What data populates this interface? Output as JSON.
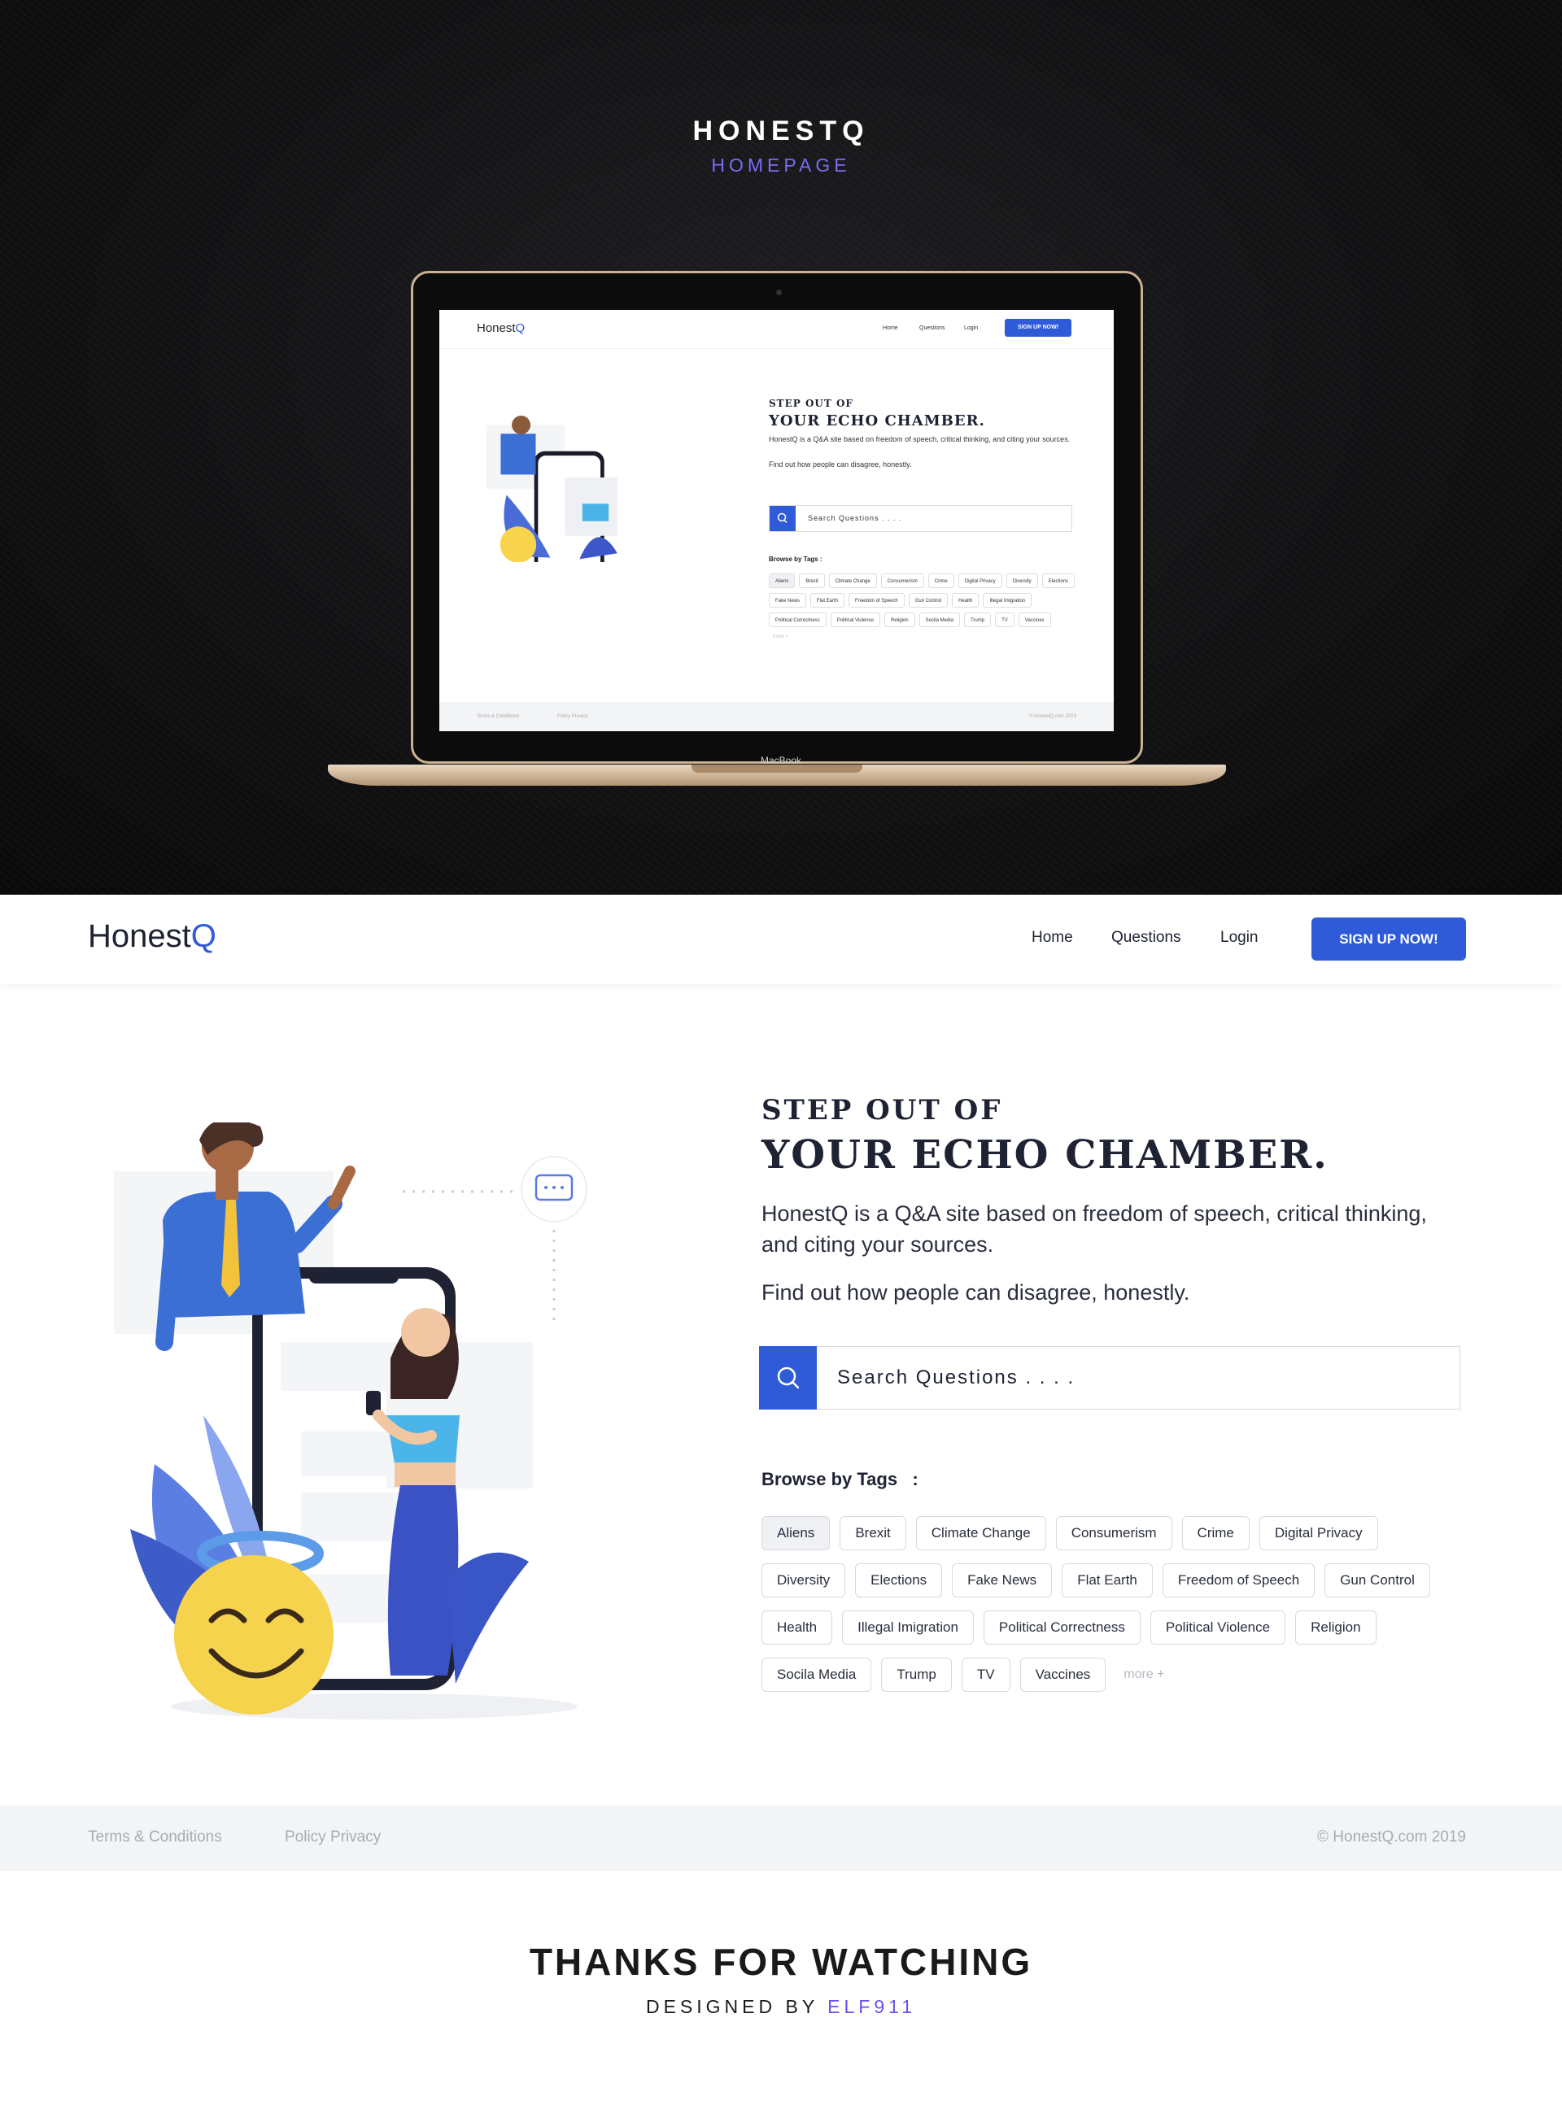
{
  "showcase": {
    "title": "HONESTQ",
    "subtitle": "HOMEPAGE",
    "laptop_label": "MacBook"
  },
  "header": {
    "logo": {
      "text": "Honest",
      "accent": "Q"
    },
    "nav": [
      {
        "label": "Home"
      },
      {
        "label": "Questions"
      },
      {
        "label": "Login"
      }
    ],
    "signup_label": "SIGN UP NOW!"
  },
  "hero": {
    "heading_small": "STEP OUT OF",
    "heading_large": "YOUR ECHO CHAMBER.",
    "description": "HonestQ is a Q&A site based on freedom of speech, critical thinking, and citing your sources.",
    "tagline": "Find out how people can disagree, honestly."
  },
  "search": {
    "placeholder": "Search Questions . . . .",
    "icon": "search-icon"
  },
  "browse": {
    "label": "Browse by Tags   :",
    "tags": [
      "Aliens",
      "Brexit",
      "Climate Change",
      "Consumerism",
      "Crime",
      "Digital Privacy",
      "Diversity",
      "Elections",
      "Fake News",
      "Flat Earth",
      "Freedom of Speech",
      "Gun Control",
      "Health",
      "Illegal Imigration",
      "Political Correctness",
      "Political Violence",
      "Religion",
      "Socila Media",
      "Trump",
      "TV",
      "Vaccines"
    ],
    "more_label": "more +"
  },
  "footer": {
    "terms": "Terms & Conditions",
    "privacy": "Policy Privacy",
    "copyright": "© HonestQ.com 2019"
  },
  "closing": {
    "thanks": "THANKS FOR WATCHING",
    "designed_by": "DESIGNED BY",
    "author": "ELF911"
  },
  "colors": {
    "accent": "#2f5bd8",
    "subtitle_purple": "#7a6cf5",
    "author_purple": "#6a4ff0",
    "footer_bg": "#f3f4f6",
    "showcase_bg": "#121214"
  }
}
